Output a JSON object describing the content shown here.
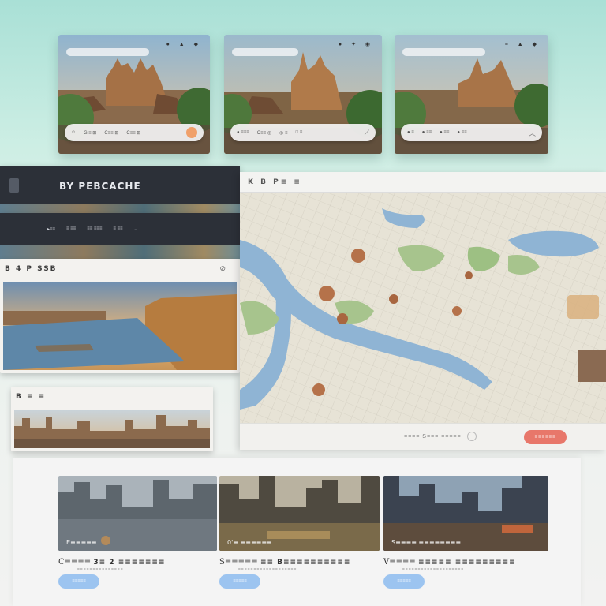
{
  "top_cards": [
    {
      "search": "",
      "icons": "● ▲ ◆",
      "bottom_items": [
        "☺",
        "Gl≡ ⊞",
        "C≡≡ ⊞",
        "C≡≡ ⊞"
      ],
      "end": "button"
    },
    {
      "search": "",
      "icons": "● ✦ ◉",
      "bottom_items": [
        "● ≡≡≡",
        "C≡≡ ◎",
        "◎ ≡",
        "□ ≡"
      ],
      "end": "arrow"
    },
    {
      "search": "",
      "icons": "≡ ▲ ◆",
      "bottom_items": [
        "● ≡",
        "● ≡≡",
        "● ≡≡",
        "● ≡≡"
      ],
      "end": "arrow"
    }
  ],
  "dark_panel": {
    "title": "BY PEBCACHE"
  },
  "dark_menu": {
    "items": [
      "▸≡≡",
      "≡ ≡≡",
      "≡≡ ≡≡≡",
      "≡ ≡≡",
      "⌄"
    ]
  },
  "card_river": {
    "header": "B 4 P SSB",
    "icon": "⊘"
  },
  "card_skyline": {
    "header": "B ≡ ≡"
  },
  "map_panel": {
    "header": "K B P≡ ≡",
    "footer_label": "≡≡≡≡ S≡≡≡ ≡≡≡≡≡",
    "cta_label": "≡≡≡≡≡≡"
  },
  "gallery": [
    {
      "thumb_text": "E≡≡≡≡≡",
      "title_a": "C≡≡≡≡",
      "title_b": "3≡  2 ≡≡≡≡≡≡≡",
      "desc": "≡≡≡≡≡≡≡≡≡≡≡≡≡≡≡",
      "button": "≡≡≡≡≡"
    },
    {
      "thumb_text": "0'≡ ≡≡≡≡≡≡",
      "title_a": "S≡≡≡≡≡",
      "title_b": "≡≡  B≡≡≡≡≡≡≡≡≡≡",
      "desc": "≡≡≡≡≡≡≡≡≡≡≡≡≡≡≡≡≡≡≡",
      "button": "≡≡≡≡≡"
    },
    {
      "thumb_text": "S≡≡≡≡ ≡≡≡≡≡≡≡≡",
      "title_a": "V≡≡≡≡",
      "title_b": "≡≡≡≡≡ ≡≡≡≡≡≡≡≡≡",
      "desc": "≡≡≡≡≡≡≡≡≡≡≡≡≡≡≡≡≡≡≡≡",
      "button": "≡≡≡≡≡"
    }
  ]
}
